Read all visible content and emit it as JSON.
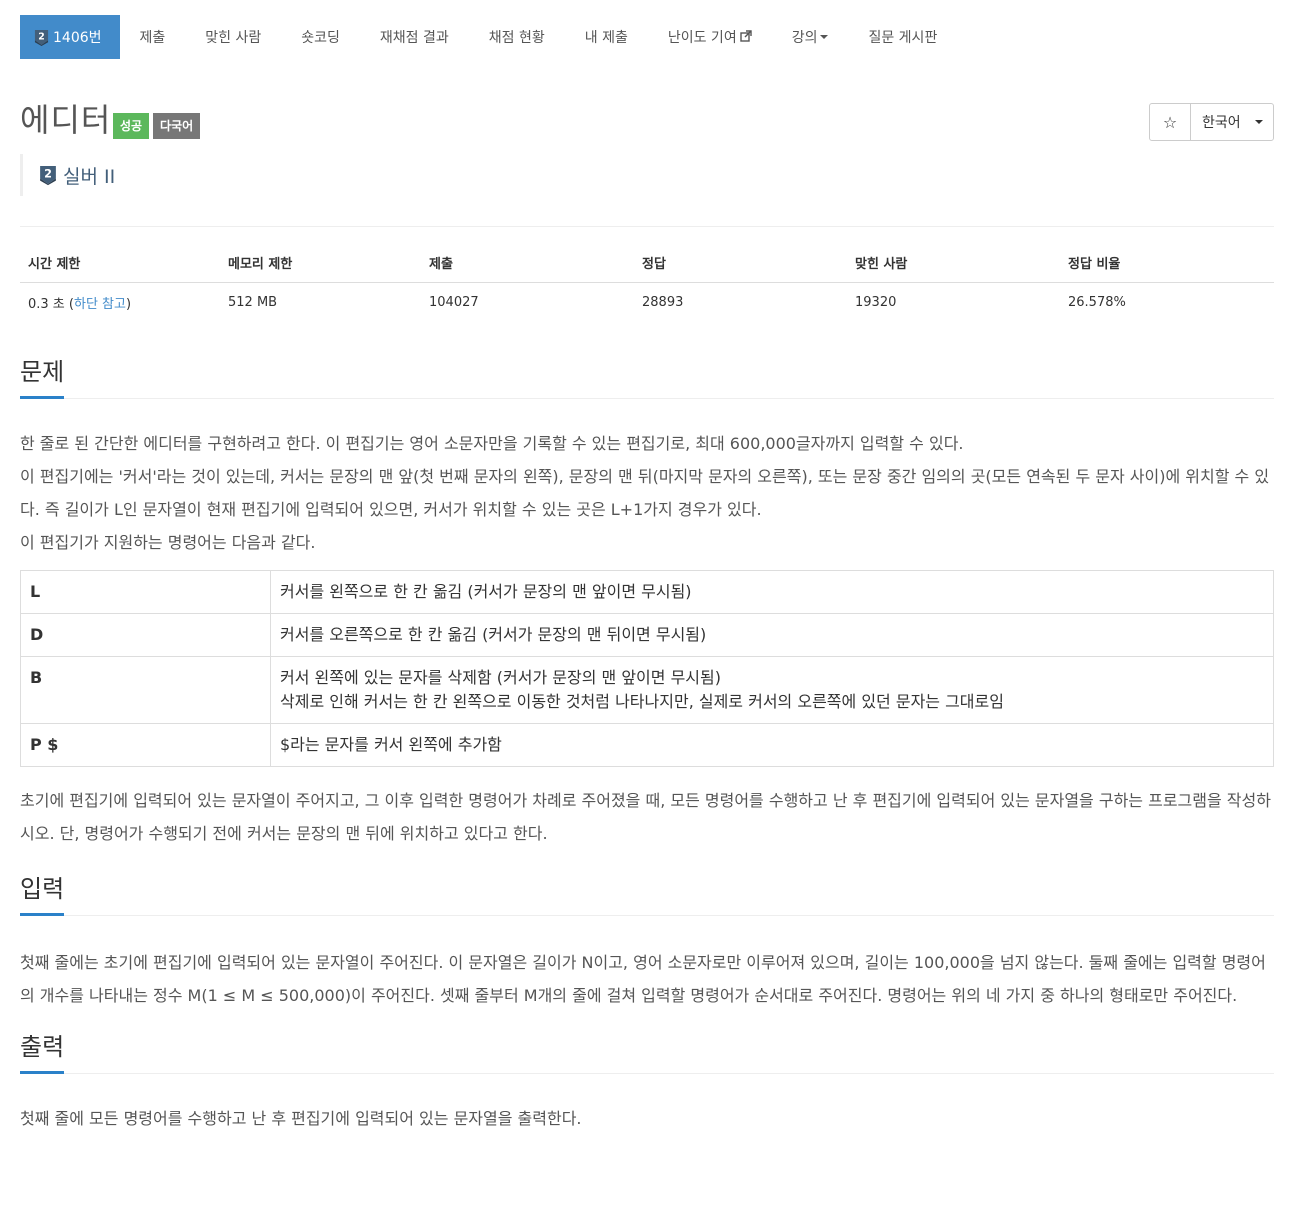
{
  "nav": {
    "problem_tab": "1406번",
    "items": [
      "제출",
      "맞힌 사람",
      "숏코딩",
      "재채점 결과",
      "채점 현황",
      "내 제출",
      "난이도 기여",
      "강의",
      "질문 게시판"
    ]
  },
  "header": {
    "title": "에디터",
    "label_success": "성공",
    "label_lang": "다국어",
    "language_selected": "한국어",
    "tier_name": "실버 II",
    "tier_number": "2"
  },
  "stats": {
    "headers": [
      "시간 제한",
      "메모리 제한",
      "제출",
      "정답",
      "맞힌 사람",
      "정답 비율"
    ],
    "time_limit_prefix": "0.3 초 (",
    "time_limit_link": "하단 참고",
    "time_limit_suffix": ")",
    "memory_limit": "512 MB",
    "submissions": "104027",
    "accepted": "28893",
    "solvers": "19320",
    "ratio": "26.578%"
  },
  "problem": {
    "heading": "문제",
    "p1": "한 줄로 된 간단한 에디터를 구현하려고 한다. 이 편집기는 영어 소문자만을 기록할 수 있는 편집기로, 최대 600,000글자까지 입력할 수 있다.",
    "p2": "이 편집기에는 '커서'라는 것이 있는데, 커서는 문장의 맨 앞(첫 번째 문자의 왼쪽), 문장의 맨 뒤(마지막 문자의 오른쪽), 또는 문장 중간 임의의 곳(모든 연속된 두 문자 사이)에 위치할 수 있다. 즉 길이가 L인 문자열이 현재 편집기에 입력되어 있으면, 커서가 위치할 수 있는 곳은 L+1가지 경우가 있다.",
    "p3": "이 편집기가 지원하는 명령어는 다음과 같다.",
    "commands": [
      {
        "key": "L",
        "desc1": "커서를 왼쪽으로 한 칸 옮김 (커서가 문장의 맨 앞이면 무시됨)",
        "desc2": ""
      },
      {
        "key": "D",
        "desc1": "커서를 오른쪽으로 한 칸 옮김 (커서가 문장의 맨 뒤이면 무시됨)",
        "desc2": ""
      },
      {
        "key": "B",
        "desc1": "커서 왼쪽에 있는 문자를 삭제함 (커서가 문장의 맨 앞이면 무시됨)",
        "desc2": "삭제로 인해 커서는 한 칸 왼쪽으로 이동한 것처럼 나타나지만, 실제로 커서의 오른쪽에 있던 문자는 그대로임"
      },
      {
        "key": "P $",
        "desc1": "$라는 문자를 커서 왼쪽에 추가함",
        "desc2": ""
      }
    ],
    "p4": "초기에 편집기에 입력되어 있는 문자열이 주어지고, 그 이후 입력한 명령어가 차례로 주어졌을 때, 모든 명령어를 수행하고 난 후 편집기에 입력되어 있는 문자열을 구하는 프로그램을 작성하시오. 단, 명령어가 수행되기 전에 커서는 문장의 맨 뒤에 위치하고 있다고 한다."
  },
  "input": {
    "heading": "입력",
    "text": "첫째 줄에는 초기에 편집기에 입력되어 있는 문자열이 주어진다. 이 문자열은 길이가 N이고, 영어 소문자로만 이루어져 있으며, 길이는 100,000을 넘지 않는다. 둘째 줄에는 입력할 명령어의 개수를 나타내는 정수 M(1 ≤ M ≤ 500,000)이 주어진다. 셋째 줄부터 M개의 줄에 걸쳐 입력할 명령어가 순서대로 주어진다. 명령어는 위의 네 가지 중 하나의 형태로만 주어진다."
  },
  "output": {
    "heading": "출력",
    "text": "첫째 줄에 모든 명령어를 수행하고 난 후 편집기에 입력되어 있는 문자열을 출력한다."
  },
  "colors": {
    "primary": "#428bca",
    "success": "#5cb85c",
    "muted": "#777777",
    "tier_silver": "#435f7a",
    "section_underline": "#2a81c9"
  },
  "icons": [
    "tier-silver-icon",
    "external-link-icon",
    "star-icon",
    "caret-down-icon"
  ]
}
